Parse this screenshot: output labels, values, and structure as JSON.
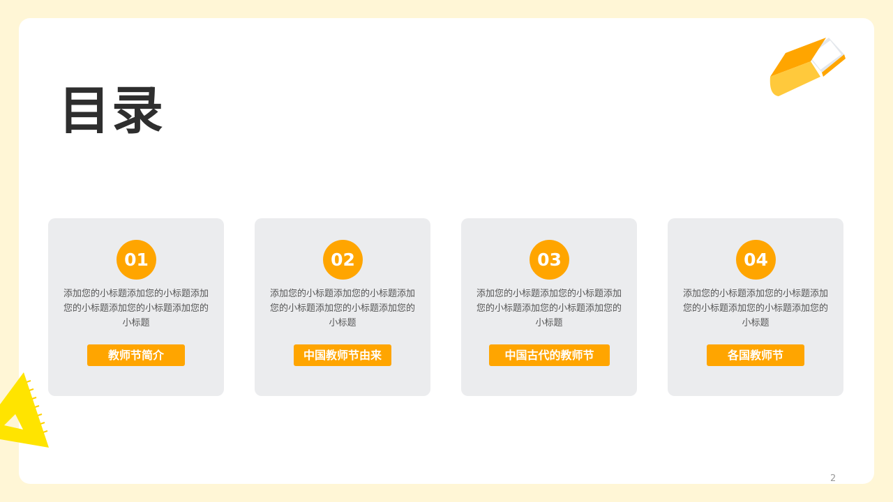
{
  "title": "目录",
  "cards": [
    {
      "number": "01",
      "description": "添加您的小标题添加您的小标题添加您的小标题添加您的小标题添加您的小标题",
      "label": "教师节简介"
    },
    {
      "number": "02",
      "description": "添加您的小标题添加您的小标题添加您的小标题添加您的小标题添加您的小标题",
      "label": "中国教师节由来"
    },
    {
      "number": "03",
      "description": "添加您的小标题添加您的小标题添加您的小标题添加您的小标题添加您的小标题",
      "label": "中国古代的教师节"
    },
    {
      "number": "04",
      "description": "添加您的小标题添加您的小标题添加您的小标题添加您的小标题添加您的小标题",
      "label": "各国教师节"
    }
  ],
  "page_number": "2",
  "colors": {
    "accent": "#FFA500",
    "background": "#FFF6D6",
    "card": "#EBECEE",
    "ruler": "#FFE400"
  },
  "icons": {
    "book": "book-icon",
    "ruler": "triangle-ruler-icon"
  }
}
